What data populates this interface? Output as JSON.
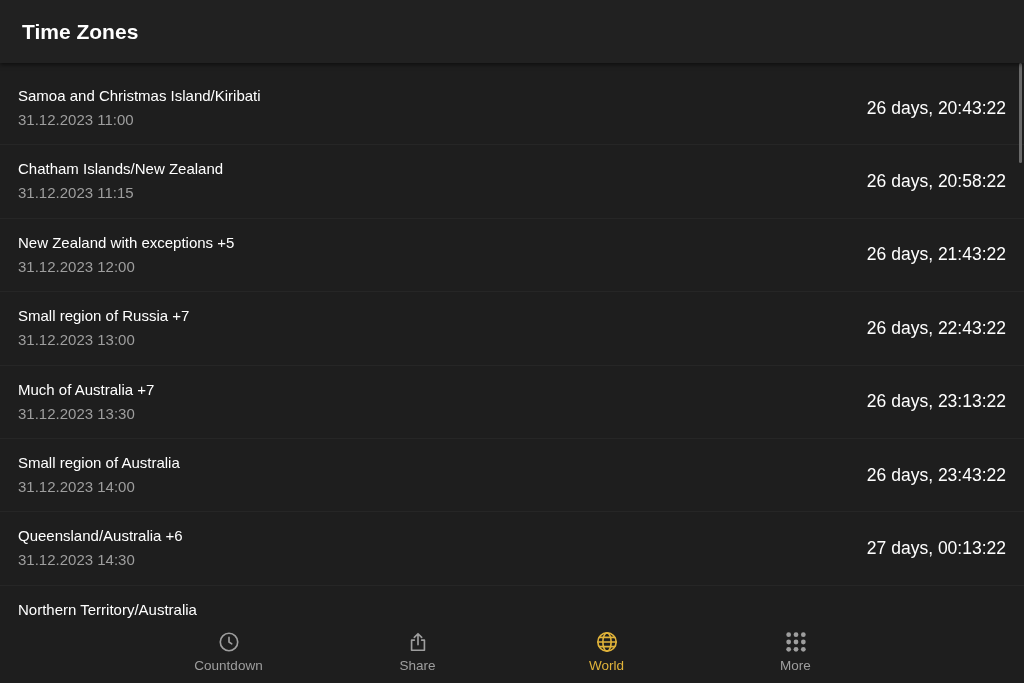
{
  "app_bar": {
    "title": "Time Zones"
  },
  "zones": [
    {
      "name": "Samoa and Christmas Island/Kiribati",
      "date": "31.12.2023 11:00",
      "countdown": "26 days, 20:43:22"
    },
    {
      "name": "Chatham Islands/New Zealand",
      "date": "31.12.2023 11:15",
      "countdown": "26 days, 20:58:22"
    },
    {
      "name": "New Zealand with exceptions +5",
      "date": "31.12.2023 12:00",
      "countdown": "26 days, 21:43:22"
    },
    {
      "name": "Small region of Russia +7",
      "date": "31.12.2023 13:00",
      "countdown": "26 days, 22:43:22"
    },
    {
      "name": "Much of Australia +7",
      "date": "31.12.2023 13:30",
      "countdown": "26 days, 23:13:22"
    },
    {
      "name": "Small region of Australia",
      "date": "31.12.2023 14:00",
      "countdown": "26 days, 23:43:22"
    },
    {
      "name": "Queensland/Australia +6",
      "date": "31.12.2023 14:30",
      "countdown": "27 days, 00:13:22"
    },
    {
      "name": "Northern Territory/Australia"
    }
  ],
  "bottom_nav": [
    {
      "kind": "clock",
      "label": "Countdown",
      "selected": false
    },
    {
      "kind": "share",
      "label": "Share",
      "selected": false
    },
    {
      "kind": "globe",
      "label": "World",
      "selected": true
    },
    {
      "kind": "grid",
      "label": "More",
      "selected": false
    }
  ]
}
